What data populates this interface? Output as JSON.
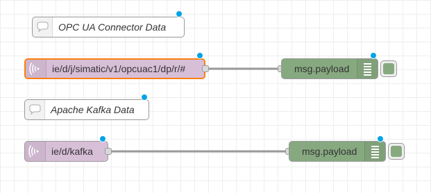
{
  "flow": {
    "comments": [
      {
        "label": "OPC UA Connector Data"
      },
      {
        "label": "Apache Kafka Data"
      }
    ],
    "inputs": [
      {
        "topic": "ie/d/j/simatic/v1/opcuac1/dp/r/#",
        "selected": true
      },
      {
        "topic": "ie/d/kafka",
        "selected": false
      }
    ],
    "outputs": [
      {
        "label": "msg.payload"
      },
      {
        "label": "msg.payload"
      }
    ]
  },
  "colors": {
    "grid_line": "#eeeeee",
    "mqtt_node": "#d8bfd8",
    "debug_node": "#87a980",
    "selection_outline": "#ff7f0e",
    "changed_dot": "#00a4e4",
    "wire": "#999999"
  },
  "icons": {
    "comment": "comment-icon",
    "mqtt": "wifi-signal-icon",
    "debug": "debug-list-icon"
  }
}
